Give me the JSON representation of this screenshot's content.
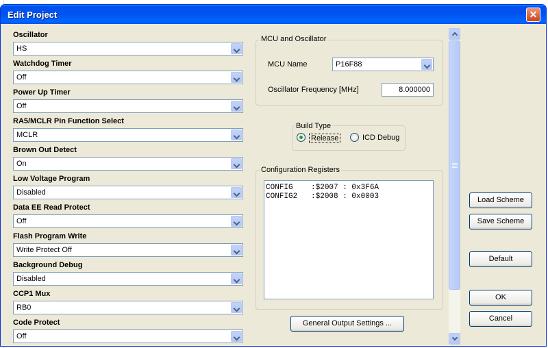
{
  "window": {
    "title": "Edit Project"
  },
  "options": [
    {
      "label": "Oscillator",
      "value": "HS"
    },
    {
      "label": "Watchdog Timer",
      "value": "Off"
    },
    {
      "label": "Power Up Timer",
      "value": "Off"
    },
    {
      "label": "RA5/MCLR Pin Function Select",
      "value": "MCLR"
    },
    {
      "label": "Brown Out Detect",
      "value": "On"
    },
    {
      "label": "Low Voltage Program",
      "value": "Disabled"
    },
    {
      "label": "Data EE Read Protect",
      "value": "Off"
    },
    {
      "label": "Flash Program Write",
      "value": "Write Protect Off"
    },
    {
      "label": "Background Debug",
      "value": "Disabled"
    },
    {
      "label": "CCP1 Mux",
      "value": "RB0"
    },
    {
      "label": "Code Protect",
      "value": "Off"
    }
  ],
  "mcu": {
    "group_title": "MCU and Oscillator",
    "name_label": "MCU Name",
    "name_value": "P16F88",
    "freq_label": "Oscillator Frequency [MHz]",
    "freq_value": "8.000000"
  },
  "build": {
    "group_title": "Build Type",
    "release_label": "Release",
    "icd_label": "ICD Debug",
    "selected": "Release"
  },
  "config": {
    "group_title": "Configuration Registers",
    "lines": [
      "CONFIG    :$2007 : 0x3F6A",
      "CONFIG2   :$2008 : 0x0003"
    ]
  },
  "buttons": {
    "general_output": "General Output Settings ...",
    "load_scheme": "Load Scheme",
    "save_scheme": "Save Scheme",
    "default": "Default",
    "ok": "OK",
    "cancel": "Cancel"
  },
  "colors": {
    "dialog_bg": "#ece9d8",
    "titlebar": "#0053ee",
    "close_button": "#c8451a"
  }
}
